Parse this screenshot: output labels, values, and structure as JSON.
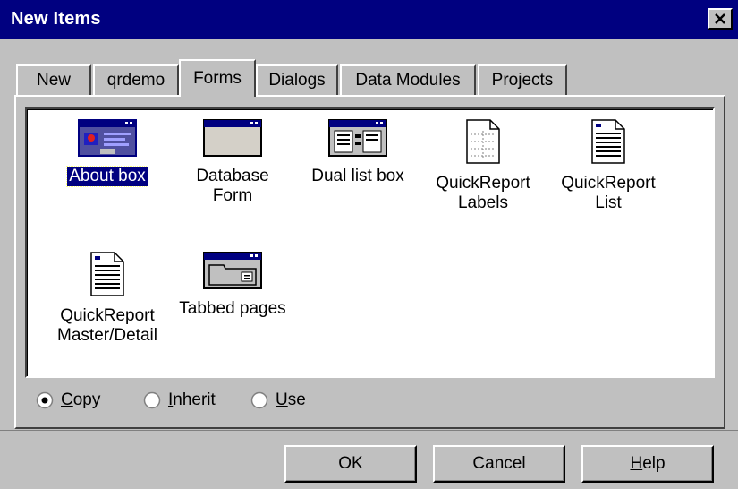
{
  "window": {
    "title": "New Items"
  },
  "tabs": [
    {
      "label": "New",
      "active": false
    },
    {
      "label": "qrdemo",
      "active": false
    },
    {
      "label": "Forms",
      "active": true
    },
    {
      "label": "Dialogs",
      "active": false
    },
    {
      "label": "Data Modules",
      "active": false
    },
    {
      "label": "Projects",
      "active": false
    }
  ],
  "items": [
    {
      "line1": "About box",
      "line2": "",
      "icon": "about-box-form-icon",
      "selected": true
    },
    {
      "line1": "Database",
      "line2": "Form",
      "icon": "database-form-icon"
    },
    {
      "line1": "Dual list box",
      "line2": "",
      "icon": "dual-list-box-icon"
    },
    {
      "line1": "QuickReport",
      "line2": "Labels",
      "icon": "report-labels-icon"
    },
    {
      "line1": "QuickReport",
      "line2": "List",
      "icon": "report-list-icon"
    },
    {
      "line1": "QuickReport",
      "line2": "Master/Detail",
      "icon": "report-master-detail-icon"
    },
    {
      "line1": "Tabbed pages",
      "line2": "",
      "icon": "tabbed-pages-icon"
    }
  ],
  "options": [
    {
      "key": "C",
      "rest": "opy",
      "selected": true
    },
    {
      "key": "I",
      "rest": "nherit",
      "selected": false
    },
    {
      "key": "U",
      "rest": "se",
      "selected": false
    }
  ],
  "buttons": {
    "ok": "OK",
    "cancel": "Cancel",
    "help_key": "H",
    "help_rest": "elp"
  },
  "colors": {
    "titlebar": "#000080",
    "face": "#c0c0c0",
    "selection": "#000080"
  }
}
